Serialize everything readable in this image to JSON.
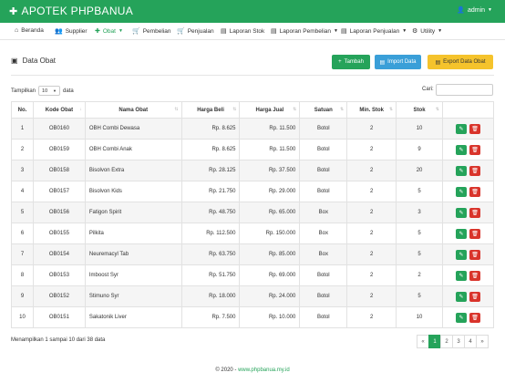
{
  "brand": {
    "icon": "pills-icon",
    "title": "APOTEK PHPBANUA"
  },
  "user": {
    "icon": "user-icon",
    "name": "admin"
  },
  "nav": [
    {
      "label": "Beranda",
      "icon": "home-icon",
      "dropdown": false,
      "active": false
    },
    {
      "label": "Supplier",
      "icon": "users-icon",
      "dropdown": false,
      "active": false
    },
    {
      "label": "Obat",
      "icon": "medkit-icon",
      "dropdown": true,
      "active": true
    },
    {
      "label": "Pembelian",
      "icon": "cart-icon",
      "dropdown": false,
      "active": false
    },
    {
      "label": "Penjualan",
      "icon": "cart-icon",
      "dropdown": false,
      "active": false
    },
    {
      "label": "Laporan Stok",
      "icon": "file-icon",
      "dropdown": false,
      "active": false
    },
    {
      "label": "Laporan Pembelian",
      "icon": "file-icon",
      "dropdown": true,
      "active": false
    },
    {
      "label": "Laporan Penjualan",
      "icon": "file-icon",
      "dropdown": true,
      "active": false
    },
    {
      "label": "Utility",
      "icon": "user-gear-icon",
      "dropdown": true,
      "active": false
    }
  ],
  "page": {
    "title": "Data Obat",
    "icon": "clone-icon"
  },
  "buttons": {
    "tambah": "Tambah",
    "import": "Import Data",
    "export": "Export Data Obat"
  },
  "length": {
    "prefix": "Tampilkan",
    "value": "10",
    "suffix": "data"
  },
  "search": {
    "label": "Cari:",
    "value": ""
  },
  "table": {
    "columns": [
      "No.",
      "Kode Obat",
      "Nama Obat",
      "Harga Beli",
      "Harga Jual",
      "Satuan",
      "Min. Stok",
      "Stok",
      ""
    ],
    "rows": [
      [
        "1",
        "OB0160",
        "OBH Combi Dewasa",
        "Rp. 8.625",
        "Rp. 11.500",
        "Botol",
        "2",
        "10"
      ],
      [
        "2",
        "OB0159",
        "OBH Combi Anak",
        "Rp. 8.625",
        "Rp. 11.500",
        "Botol",
        "2",
        "9"
      ],
      [
        "3",
        "OB0158",
        "Bisolvon Extra",
        "Rp. 28.125",
        "Rp. 37.500",
        "Botol",
        "2",
        "20"
      ],
      [
        "4",
        "OB0157",
        "Bisolvon Kids",
        "Rp. 21.750",
        "Rp. 29.000",
        "Botol",
        "2",
        "5"
      ],
      [
        "5",
        "OB0156",
        "Fatigon Spirit",
        "Rp. 48.750",
        "Rp. 65.000",
        "Box",
        "2",
        "3"
      ],
      [
        "6",
        "OB0155",
        "Pilkita",
        "Rp. 112.500",
        "Rp. 150.000",
        "Box",
        "2",
        "5"
      ],
      [
        "7",
        "OB0154",
        "Neuremacyl Tab",
        "Rp. 63.750",
        "Rp. 85.000",
        "Box",
        "2",
        "5"
      ],
      [
        "8",
        "OB0153",
        "Imboost Syr",
        "Rp. 51.750",
        "Rp. 69.000",
        "Botol",
        "2",
        "2"
      ],
      [
        "9",
        "OB0152",
        "Stimuno Syr",
        "Rp. 18.000",
        "Rp. 24.000",
        "Botol",
        "2",
        "5"
      ],
      [
        "10",
        "OB0151",
        "Sakatonik Liver",
        "Rp. 7.500",
        "Rp. 10.000",
        "Botol",
        "2",
        "10"
      ]
    ]
  },
  "info": "Menampilkan 1 sampai 10 dari 38 data",
  "pagination": [
    "«",
    "1",
    "2",
    "3",
    "4",
    "»"
  ],
  "pagination_active": "1",
  "footer": {
    "text": "© 2020 - ",
    "link": "www.phpbanua.my.id"
  },
  "colors": {
    "primary": "#25a35a",
    "info": "#3a9fd8",
    "warning": "#f5c32c",
    "danger": "#d9342b"
  }
}
